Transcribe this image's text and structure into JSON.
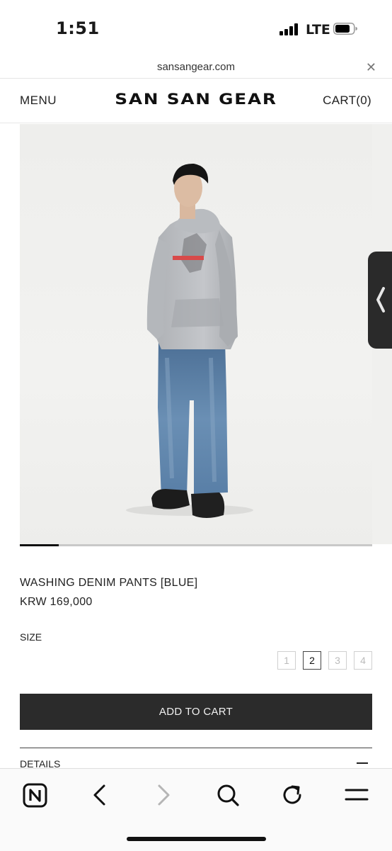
{
  "status_bar": {
    "time": "1:51",
    "network": "LTE"
  },
  "browser": {
    "url": "sansangear.com",
    "close_symbol": "✕"
  },
  "header": {
    "menu_label": "MENU",
    "brand": "SAN SAN GEAR",
    "cart_label": "CART(0)"
  },
  "carousel": {
    "progress_fraction": 0.11
  },
  "product": {
    "name": "WASHING DENIM PANTS [BLUE]",
    "price": "KRW 169,000",
    "size_label": "SIZE",
    "sizes": [
      "1",
      "2",
      "3",
      "4"
    ],
    "selected_size": "2",
    "add_to_cart_label": "ADD TO CART",
    "details_label": "DETAILS"
  },
  "toolbar": {
    "icons": [
      "naver-home-icon",
      "back-icon",
      "forward-icon",
      "search-icon",
      "reload-icon",
      "menu-icon"
    ]
  },
  "colors": {
    "button_bg": "#2b2b2b",
    "hoodie": "#b9bcc0",
    "denim": "#5f83a8"
  }
}
